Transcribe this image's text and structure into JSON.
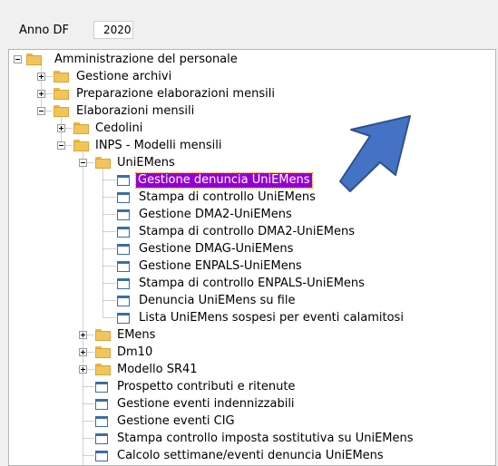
{
  "header": {
    "anno_label": "Anno DF",
    "anno_value": "2020"
  },
  "tree": {
    "items": [
      {
        "label": "Amministrazione del personale",
        "type": "folder",
        "expander": "minus"
      },
      {
        "label": "Gestione archivi",
        "type": "folder",
        "expander": "plus"
      },
      {
        "label": "Preparazione elaborazioni mensili",
        "type": "folder",
        "expander": "plus"
      },
      {
        "label": "Elaborazioni mensili",
        "type": "folder",
        "expander": "minus"
      },
      {
        "label": "Cedolini",
        "type": "folder",
        "expander": "plus"
      },
      {
        "label": "INPS - Modelli mensili",
        "type": "folder",
        "expander": "minus"
      },
      {
        "label": "UniEMens",
        "type": "folder",
        "expander": "minus"
      },
      {
        "label": "Gestione denuncia UniEMens",
        "type": "page",
        "selected": true
      },
      {
        "label": "Stampa di controllo UniEMens",
        "type": "page"
      },
      {
        "label": "Gestione DMA2-UniEMens",
        "type": "page"
      },
      {
        "label": "Stampa di controllo DMA2-UniEMens",
        "type": "page"
      },
      {
        "label": "Gestione DMAG-UniEMens",
        "type": "page"
      },
      {
        "label": "Gestione ENPALS-UniEMens",
        "type": "page"
      },
      {
        "label": "Stampa di controllo ENPALS-UniEMens",
        "type": "page"
      },
      {
        "label": "Denuncia UniEMens su file",
        "type": "page"
      },
      {
        "label": "Lista UniEMens sospesi per eventi calamitosi",
        "type": "page"
      },
      {
        "label": "EMens",
        "type": "folder",
        "expander": "plus"
      },
      {
        "label": "Dm10",
        "type": "folder",
        "expander": "plus"
      },
      {
        "label": "Modello SR41",
        "type": "folder",
        "expander": "plus"
      },
      {
        "label": "Prospetto contributi e ritenute",
        "type": "page"
      },
      {
        "label": "Gestione eventi indennizzabili",
        "type": "page"
      },
      {
        "label": "Gestione eventi CIG",
        "type": "page"
      },
      {
        "label": "Stampa controllo imposta sostitutiva su UniEMens",
        "type": "page"
      },
      {
        "label": "Calcolo settimane/eventi denuncia UniEMens",
        "type": "page"
      }
    ]
  },
  "annotation": {
    "arrow_color": "#4472c4",
    "arrow_icon": "arrow-pointing-down-left"
  },
  "colors": {
    "selection": "#9400d3"
  }
}
